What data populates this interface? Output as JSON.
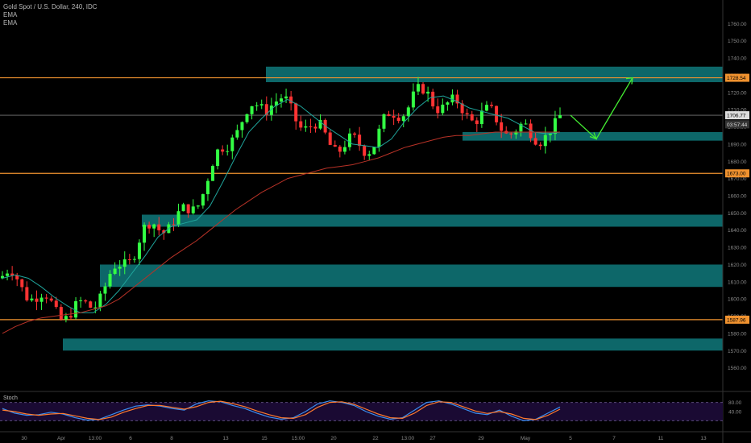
{
  "header": {
    "symbol_line": "Gold Spot / U.S. Dollar, 240, IDC",
    "indicators": [
      "EMA",
      "EMA"
    ]
  },
  "colors": {
    "background": "#000000",
    "candle_up": "#33ff44",
    "candle_down": "#ff3333",
    "zone_fill": "#0e6d6f",
    "level_line": "#f0922f",
    "ema_fast": "#1fa39a",
    "ema_slow": "#b83227",
    "arrow": "#44ee33",
    "stoch_k": "#3a8ef0",
    "stoch_d": "#ff7a2e",
    "stoch_bg": "#1a0a33"
  },
  "stoch_label": "Stoch",
  "chart_data": [
    {
      "type": "candlestick",
      "title": "Gold Spot / U.S. Dollar, 240, IDC",
      "xlabel": "",
      "ylabel": "",
      "ylim": [
        1550,
        1770
      ],
      "y_ticks": [
        1560,
        1570,
        1580,
        1590,
        1600,
        1610,
        1620,
        1630,
        1640,
        1650,
        1660,
        1670,
        1680,
        1690,
        1700,
        1710,
        1720,
        1730,
        1740,
        1750,
        1760
      ],
      "x_tick_labels": [
        "30",
        "Apr",
        "13:00",
        "6",
        "8",
        "13",
        "15",
        "15:00",
        "20",
        "22",
        "13:00",
        "27",
        "29",
        "May",
        "5",
        "7",
        "11",
        "13"
      ],
      "price_labels": [
        {
          "text": "1728.54",
          "value": 1728.54,
          "style": "level"
        },
        {
          "text": "1706.77",
          "value": 1706.77,
          "style": "current"
        },
        {
          "text": "03:57:44",
          "value": 1701.5,
          "style": "timer"
        },
        {
          "text": "1673.00",
          "value": 1673.0,
          "style": "level"
        },
        {
          "text": "1587.96",
          "value": 1587.96,
          "style": "level"
        }
      ],
      "horizontal_levels": [
        1728.54,
        1706.77,
        1673.0,
        1587.96
      ],
      "zones": [
        {
          "top": 1735,
          "bottom": 1726
        },
        {
          "top": 1697,
          "bottom": 1692
        },
        {
          "top": 1649,
          "bottom": 1642
        },
        {
          "top": 1620,
          "bottom": 1607
        },
        {
          "top": 1577,
          "bottom": 1570
        }
      ],
      "series": [
        {
          "name": "EMA",
          "values": [
            1612,
            1614,
            1612,
            1607,
            1601,
            1596,
            1592,
            1592,
            1597,
            1605,
            1615,
            1625,
            1636,
            1642,
            1644,
            1646,
            1654,
            1668,
            1683,
            1697,
            1705,
            1712,
            1716,
            1712,
            1706,
            1700,
            1695,
            1690,
            1689,
            1688,
            1693,
            1703,
            1711,
            1717,
            1718,
            1715,
            1711,
            1709,
            1707,
            1705,
            1701,
            1697,
            1696,
            1697
          ]
        },
        {
          "name": "EMA",
          "values": [
            1580,
            1584,
            1587,
            1589,
            1590,
            1591,
            1592,
            1594,
            1596,
            1600,
            1606,
            1612,
            1618,
            1624,
            1629,
            1634,
            1640,
            1646,
            1652,
            1657,
            1662,
            1666,
            1670,
            1672,
            1674,
            1676,
            1677,
            1678,
            1680,
            1682,
            1685,
            1688,
            1690,
            1692,
            1694,
            1695,
            1695,
            1696,
            1697,
            1697,
            1697,
            1697,
            1697,
            1697
          ]
        }
      ],
      "projection": [
        1706.77,
        1693,
        1728.54
      ]
    },
    {
      "type": "line",
      "title": "Stoch",
      "ylim": [
        0,
        100
      ],
      "y_tick_labels": [
        "80.00",
        "40.00"
      ],
      "series": [
        {
          "name": "",
          "values": [
            60,
            45,
            38,
            40,
            48,
            42,
            30,
            22,
            25,
            40,
            55,
            68,
            72,
            68,
            60,
            55,
            75,
            85,
            82,
            70,
            60,
            45,
            32,
            25,
            30,
            50,
            75,
            85,
            80,
            70,
            50,
            35,
            25,
            30,
            55,
            80,
            85,
            75,
            60,
            45,
            40,
            55,
            35,
            20,
            25,
            45,
            65
          ]
        },
        {
          "name": "",
          "values": [
            55,
            50,
            42,
            38,
            42,
            44,
            36,
            28,
            24,
            32,
            48,
            60,
            70,
            70,
            64,
            58,
            66,
            80,
            84,
            76,
            66,
            52,
            40,
            30,
            28,
            40,
            64,
            80,
            82,
            74,
            58,
            42,
            30,
            28,
            45,
            70,
            82,
            80,
            66,
            52,
            44,
            50,
            42,
            28,
            24,
            38,
            58
          ]
        }
      ]
    }
  ]
}
